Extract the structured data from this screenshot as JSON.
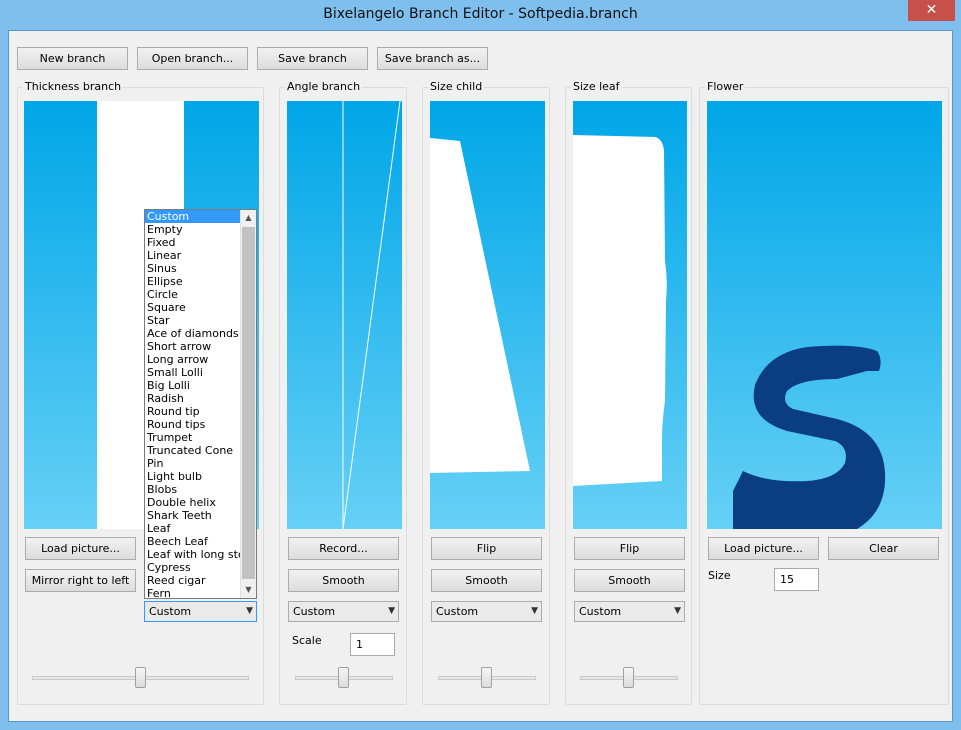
{
  "window": {
    "title": "Bixelangelo Branch Editor - Softpedia.branch",
    "close_label": "✕"
  },
  "toolbar": {
    "new_label": "New branch",
    "open_label": "Open branch...",
    "save_label": "Save branch",
    "save_as_label": "Save branch as..."
  },
  "thickness": {
    "title": "Thickness branch",
    "load_label": "Load picture...",
    "mirror_label": "Mirror right to left",
    "select_value": "Custom",
    "slider_value": 0.5,
    "options": [
      "Custom",
      "Empty",
      "Fixed",
      "Linear",
      "Sinus",
      "Ellipse",
      "Circle",
      "Square",
      "Star",
      "Ace of diamonds",
      "Short arrow",
      "Long arrow",
      "Small Lolli",
      "Big Lolli",
      "Radish",
      "Round tip",
      "Round tips",
      "Trumpet",
      "Truncated Cone",
      "Pin",
      "Light bulb",
      "Blobs",
      "Double helix",
      "Shark Teeth",
      "Leaf",
      "Beech Leaf",
      "Leaf with long stem",
      "Cypress",
      "Reed cigar",
      "Fern"
    ]
  },
  "angle": {
    "title": "Angle branch",
    "record_label": "Record...",
    "smooth_label": "Smooth",
    "select_value": "Custom",
    "scale_label": "Scale",
    "scale_value": "1",
    "slider_value": 0.5
  },
  "size_child": {
    "title": "Size child",
    "flip_label": "Flip",
    "smooth_label": "Smooth",
    "select_value": "Custom",
    "slider_value": 0.5
  },
  "size_leaf": {
    "title": "Size leaf",
    "flip_label": "Flip",
    "smooth_label": "Smooth",
    "select_value": "Custom",
    "slider_value": 0.5
  },
  "flower": {
    "title": "Flower",
    "load_label": "Load picture...",
    "clear_label": "Clear",
    "size_label": "Size",
    "size_value": "15"
  },
  "colors": {
    "canvas_top": "#00a6e8",
    "canvas_bottom": "#66d0f6",
    "shape": "#ffffff",
    "flower_glyph": "#0a3d82"
  }
}
